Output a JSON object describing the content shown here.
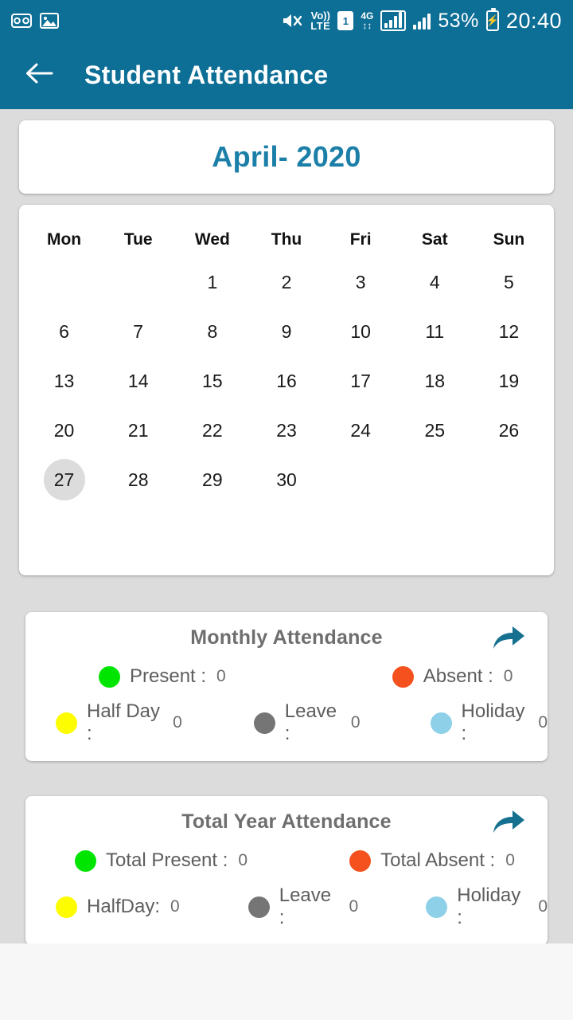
{
  "status_bar": {
    "left_icons": [
      "voicemail-icon",
      "image-icon"
    ],
    "right_icons": [
      "mute-icon",
      "volte-icon",
      "sim1-icon",
      "4g-icon",
      "signal-icon",
      "signal-icon-2"
    ],
    "volte_line1": "Vo))",
    "volte_line2": "LTE",
    "sim_label": "1",
    "network_line1": "4G",
    "battery_percent": "53%",
    "clock": "20:40"
  },
  "app_bar": {
    "back_label": "back",
    "title": "Student Attendance"
  },
  "month_header": {
    "title": "April- 2020"
  },
  "calendar": {
    "weekdays": [
      "Mon",
      "Tue",
      "Wed",
      "Thu",
      "Fri",
      "Sat",
      "Sun"
    ],
    "weeks": [
      [
        "",
        "",
        "1",
        "2",
        "3",
        "4",
        "5"
      ],
      [
        "6",
        "7",
        "8",
        "9",
        "10",
        "11",
        "12"
      ],
      [
        "13",
        "14",
        "15",
        "16",
        "17",
        "18",
        "19"
      ],
      [
        "20",
        "21",
        "22",
        "23",
        "24",
        "25",
        "26"
      ],
      [
        "27",
        "28",
        "29",
        "30",
        "",
        "",
        ""
      ]
    ],
    "today": "27"
  },
  "monthly_attendance": {
    "title": "Monthly Attendance",
    "share_icon": "share-arrow-icon",
    "row1": [
      {
        "label": "Present :",
        "value": "0",
        "color": "#00e500"
      },
      {
        "label": "Absent :",
        "value": "0",
        "color": "#f4511e"
      }
    ],
    "row2": [
      {
        "label": "Half Day :",
        "value": "0",
        "color": "#fdfd00"
      },
      {
        "label": "Leave :",
        "value": "0",
        "color": "#757575"
      },
      {
        "label": "Holiday :",
        "value": "0",
        "color": "#8ed0e8"
      }
    ]
  },
  "total_year_attendance": {
    "title": "Total Year Attendance",
    "share_icon": "share-arrow-icon",
    "row1": [
      {
        "label": "Total Present :",
        "value": "0",
        "color": "#00e500"
      },
      {
        "label": "Total Absent :",
        "value": "0",
        "color": "#f4511e"
      }
    ],
    "row2": [
      {
        "label": "HalfDay:",
        "value": "0",
        "color": "#fdfd00"
      },
      {
        "label": "Leave :",
        "value": "0",
        "color": "#757575"
      },
      {
        "label": "Holiday :",
        "value": "0",
        "color": "#8ed0e8"
      }
    ]
  },
  "theme": {
    "primary": "#0d6e96",
    "accent": "#1b7fa8",
    "background": "#dcdcdc",
    "card": "#ffffff"
  }
}
